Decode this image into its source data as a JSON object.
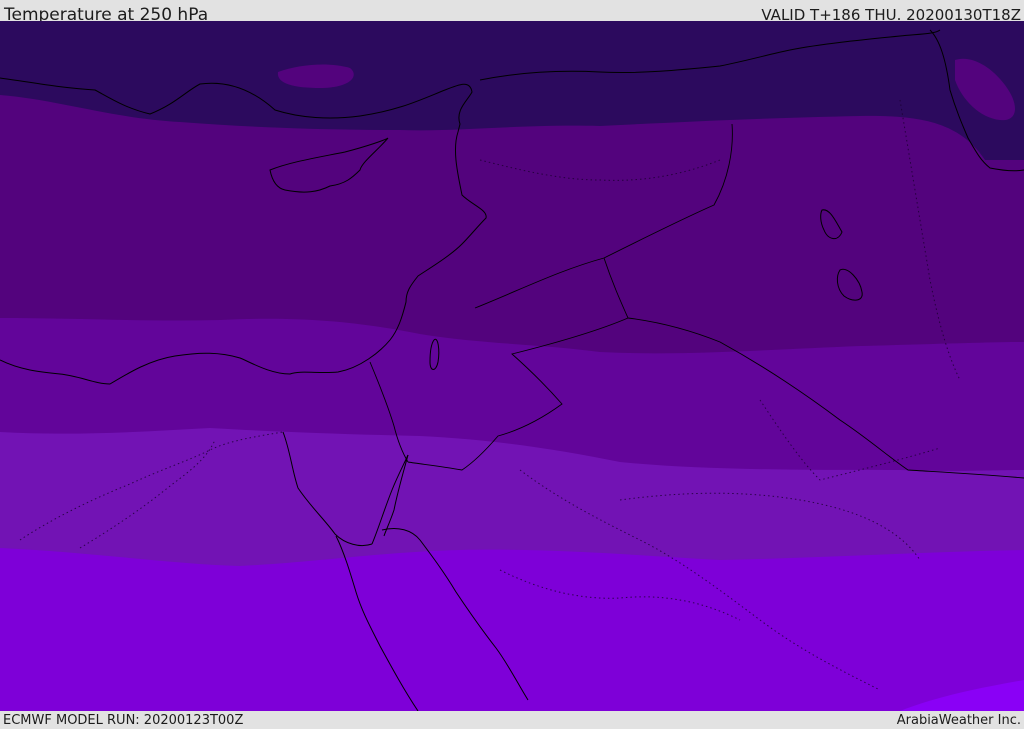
{
  "header": {
    "title": "Temperature at 250 hPa",
    "valid": "VALID T+186 THU. 20200130T18Z"
  },
  "footer": {
    "model_run": "ECMWF MODEL RUN: 20200123T00Z",
    "credit": "ArabiaWeather Inc."
  },
  "map": {
    "field": "temperature",
    "level": "250 hPa",
    "bands_north_to_south": [
      {
        "color": "#2c0a5e"
      },
      {
        "color": "#53037d"
      },
      {
        "color": "#62059a"
      },
      {
        "color": "#7213b4"
      },
      {
        "color": "#7e00d8"
      },
      {
        "color": "#8a00f6"
      }
    ],
    "lines": {
      "coastline": "#000000",
      "borders": "#000000"
    }
  }
}
